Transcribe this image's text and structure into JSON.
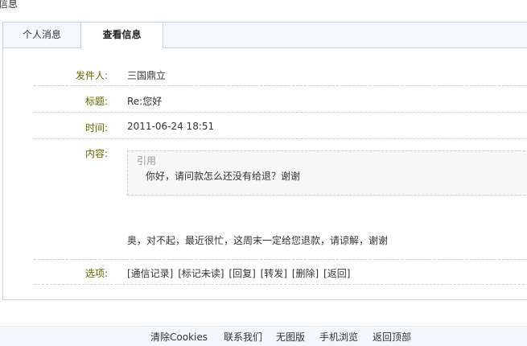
{
  "page": {
    "title": "信息"
  },
  "tabs": [
    {
      "label": "个人消息"
    },
    {
      "label": "查看信息"
    }
  ],
  "message": {
    "sender_label": "发件人:",
    "sender": "三国鼎立",
    "subject_label": "标题:",
    "subject": "Re:您好",
    "time_label": "时间:",
    "time": "2011-06-24 18:51",
    "content_label": "内容:",
    "quote_label": "引用",
    "quote_text": "你好，请问款怎么还没有给退？谢谢",
    "reply_text": "奥，对不起，最近很忙，这周末一定给您退款，请谅解，谢谢"
  },
  "options": {
    "label": "选项:",
    "links": [
      "[通信记录]",
      "[标记未读]",
      "[回复]",
      "[转发]",
      "[删除]",
      "[返回]"
    ]
  },
  "footer": {
    "links": [
      "清除Cookies",
      "联系我们",
      "无图版",
      "手机浏览",
      "返回顶部"
    ]
  }
}
